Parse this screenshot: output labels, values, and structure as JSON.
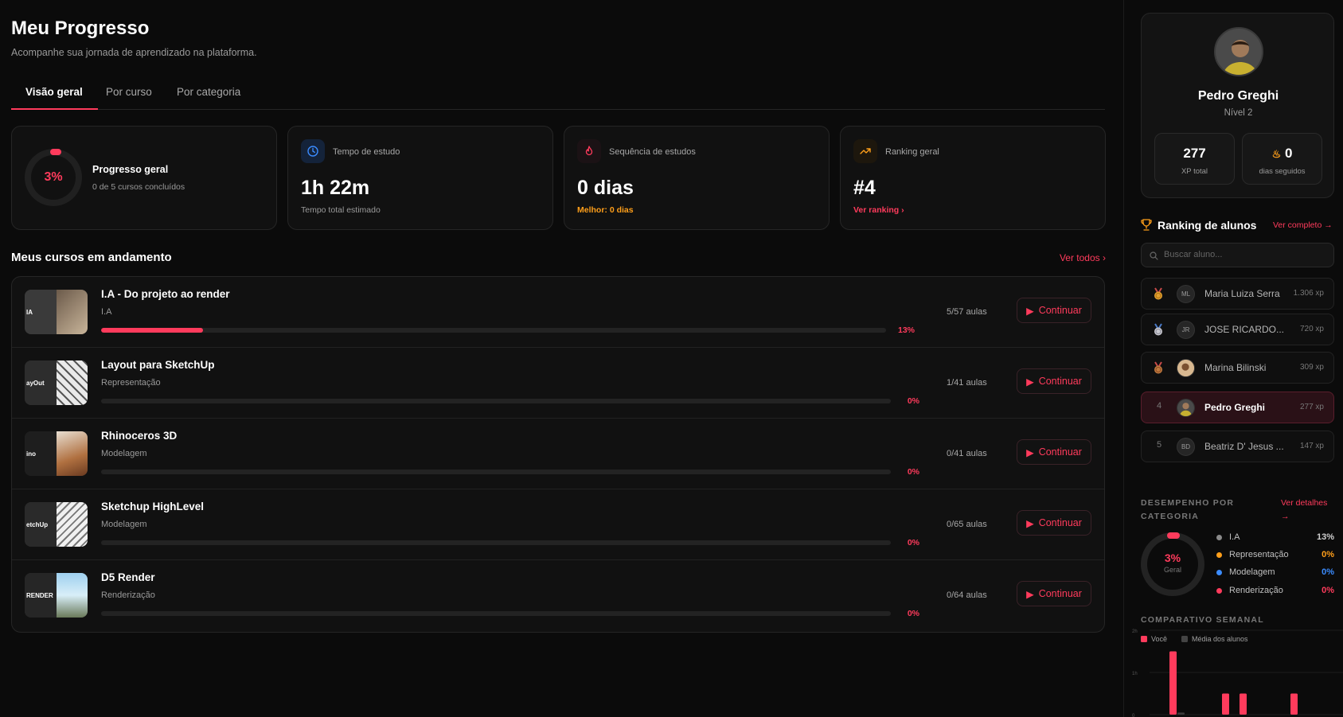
{
  "header": {
    "title": "Meu Progresso",
    "subtitle": "Acompanhe sua jornada de aprendizado na plataforma."
  },
  "tabs": [
    {
      "label": "Visão geral",
      "active": true
    },
    {
      "label": "Por curso",
      "active": false
    },
    {
      "label": "Por categoria",
      "active": false
    }
  ],
  "stats": {
    "overall": {
      "percent_text": "3%",
      "percent": 3,
      "title": "Progresso geral",
      "sub": "0 de 5 cursos concluídos"
    },
    "study_time": {
      "label": "Tempo de estudo",
      "value": "1h 22m",
      "foot": "Tempo total estimado",
      "icon": "clock-icon"
    },
    "streak": {
      "label": "Sequência de estudos",
      "value": "0 dias",
      "foot": "Melhor: 0 dias",
      "icon": "flame-icon"
    },
    "ranking": {
      "label": "Ranking geral",
      "value": "#4",
      "foot": "Ver ranking",
      "icon": "trending-up-icon"
    }
  },
  "courses_section": {
    "title": "Meus cursos em andamento",
    "see_all": "Ver todos"
  },
  "courses": [
    {
      "title": "I.A - Do projeto ao render",
      "category": "I.A",
      "progress": 13,
      "progress_text": "13%",
      "lessons": "5/57 aulas",
      "button": "Continuar",
      "thumb_text": "IA"
    },
    {
      "title": "Layout para SketchUp",
      "category": "Representação",
      "progress": 0,
      "progress_text": "0%",
      "lessons": "1/41 aulas",
      "button": "Continuar",
      "thumb_text": "ayOut"
    },
    {
      "title": "Rhinoceros 3D",
      "category": "Modelagem",
      "progress": 0,
      "progress_text": "0%",
      "lessons": "0/41 aulas",
      "button": "Continuar",
      "thumb_text": "ino"
    },
    {
      "title": "Sketchup HighLevel",
      "category": "Modelagem",
      "progress": 0,
      "progress_text": "0%",
      "lessons": "0/65 aulas",
      "button": "Continuar",
      "thumb_text": "etchUp"
    },
    {
      "title": "D5 Render",
      "category": "Renderização",
      "progress": 0,
      "progress_text": "0%",
      "lessons": "0/64 aulas",
      "button": "Continuar",
      "thumb_text": "RENDER"
    }
  ],
  "profile": {
    "name": "Pedro Greghi",
    "level": "Nível 2",
    "xp_value": "277",
    "xp_label": "XP total",
    "streak_value": "0",
    "streak_label": "dias seguidos"
  },
  "ranking": {
    "title": "Ranking de alunos",
    "link": "Ver completo →",
    "search_placeholder": "Buscar aluno...",
    "rows": [
      {
        "pos": "1",
        "medal": "gold",
        "initials": "ML",
        "name": "Maria Luiza Serra",
        "xp": "1.306 xp",
        "me": false
      },
      {
        "pos": "2",
        "medal": "silver",
        "initials": "JR",
        "name": "JOSE RICARDO...",
        "xp": "720 xp",
        "me": false
      },
      {
        "pos": "3",
        "medal": "bronze",
        "initials": "",
        "name": "Marina Bilinski",
        "xp": "309 xp",
        "me": false
      },
      {
        "pos": "4",
        "medal": "",
        "initials": "",
        "name": "Pedro Greghi",
        "xp": "277 xp",
        "me": true
      },
      {
        "pos": "5",
        "medal": "",
        "initials": "BD",
        "name": "Beatriz D' Jesus ...",
        "xp": "147 xp",
        "me": false
      }
    ]
  },
  "performance": {
    "title": "DESEMPENHO POR CATEGORIA",
    "link": "Ver detalhes →",
    "overall_text": "3%",
    "overall_label": "Geral",
    "items": [
      {
        "name": "I.A",
        "value": "13%",
        "color": "#8a8a8a",
        "value_color": "#d0d0d0"
      },
      {
        "name": "Representação",
        "value": "0%",
        "color": "#ff9f1a",
        "value_color": "#ff9f1a"
      },
      {
        "name": "Modelagem",
        "value": "0%",
        "color": "#3b8cff",
        "value_color": "#3b8cff"
      },
      {
        "name": "Renderização",
        "value": "0%",
        "color": "#ff3b5c",
        "value_color": "#ff3b5c"
      }
    ]
  },
  "weekly": {
    "title": "COMPARATIVO SEMANAL",
    "legend_you": "Você",
    "legend_avg": "Média dos alunos"
  },
  "chart_data": {
    "type": "bar",
    "title": "COMPARATIVO SEMANAL",
    "y_ticks": [
      "2h",
      "1h",
      "0"
    ],
    "ylim": [
      0,
      2
    ],
    "series": [
      {
        "name": "Você",
        "color": "#ff3b5c",
        "values": [
          1.5,
          0.5,
          0.5,
          0.5
        ]
      },
      {
        "name": "Média dos alunos",
        "color": "#3a3a3a",
        "values": [
          0.05,
          0,
          0,
          0
        ]
      }
    ]
  },
  "colors": {
    "accent": "#ff3b5c",
    "orange": "#ff9f1a",
    "blue": "#3b8cff"
  }
}
